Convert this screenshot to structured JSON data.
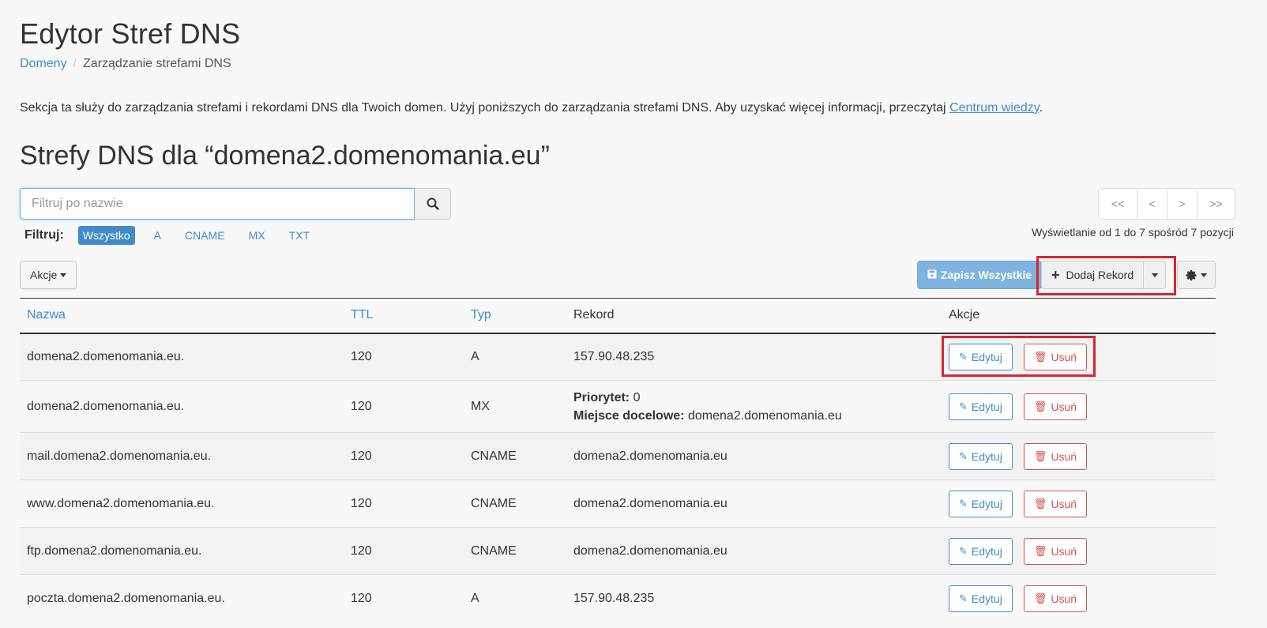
{
  "page": {
    "title": "Edytor Stref DNS",
    "breadcrumb": {
      "home": "Domeny",
      "current": "Zarządzanie strefami DNS"
    },
    "intro_text": "Sekcja ta służy do zarządzania strefami i rekordami DNS dla Twoich domen. Użyj poniższych do zarządzania strefami DNS. Aby uzyskać więcej informacji, przeczytaj ",
    "intro_link": "Centrum wiedzy",
    "intro_end": ".",
    "zones_title": "Strefy DNS dla “domena2.domenomania.eu”"
  },
  "search": {
    "placeholder": "Filtruj po nazwie",
    "icon": "search-icon"
  },
  "filter": {
    "label": "Filtruj:",
    "options": [
      "Wszystko",
      "A",
      "CNAME",
      "MX",
      "TXT"
    ],
    "active": "Wszystko"
  },
  "pager": {
    "first": "<<",
    "prev": "<",
    "next": ">",
    "last": ">>",
    "info": "Wyświetlanie od 1 do 7 spośród 7 pozycji"
  },
  "toolbar": {
    "actions_label": "Akcje",
    "save_all_label": "Zapisz Wszystkie",
    "add_record_label": "Dodaj Rekord"
  },
  "table": {
    "headers": {
      "name": "Nazwa",
      "ttl": "TTL",
      "type": "Typ",
      "record": "Rekord",
      "actions": "Akcje"
    },
    "edit_label": "Edytuj",
    "delete_label": "Usuń",
    "rows": [
      {
        "name": "domena2.domenomania.eu.",
        "ttl": "120",
        "type": "A",
        "record": "157.90.48.235"
      },
      {
        "name": "domena2.domenomania.eu.",
        "ttl": "120",
        "type": "MX",
        "priority_label": "Priorytet:",
        "priority": "0",
        "target_label": "Miejsce docelowe:",
        "target": "domena2.domenomania.eu"
      },
      {
        "name": "mail.domena2.domenomania.eu.",
        "ttl": "120",
        "type": "CNAME",
        "record": "domena2.domenomania.eu"
      },
      {
        "name": "www.domena2.domenomania.eu.",
        "ttl": "120",
        "type": "CNAME",
        "record": "domena2.domenomania.eu"
      },
      {
        "name": "ftp.domena2.domenomania.eu.",
        "ttl": "120",
        "type": "CNAME",
        "record": "domena2.domenomania.eu"
      },
      {
        "name": "poczta.domena2.domenomania.eu.",
        "ttl": "120",
        "type": "A",
        "record": "157.90.48.235"
      }
    ]
  },
  "colors": {
    "link": "#428bca",
    "danger": "#d9534f",
    "highlight": "#d9252f",
    "save": "#7fb3e0"
  }
}
